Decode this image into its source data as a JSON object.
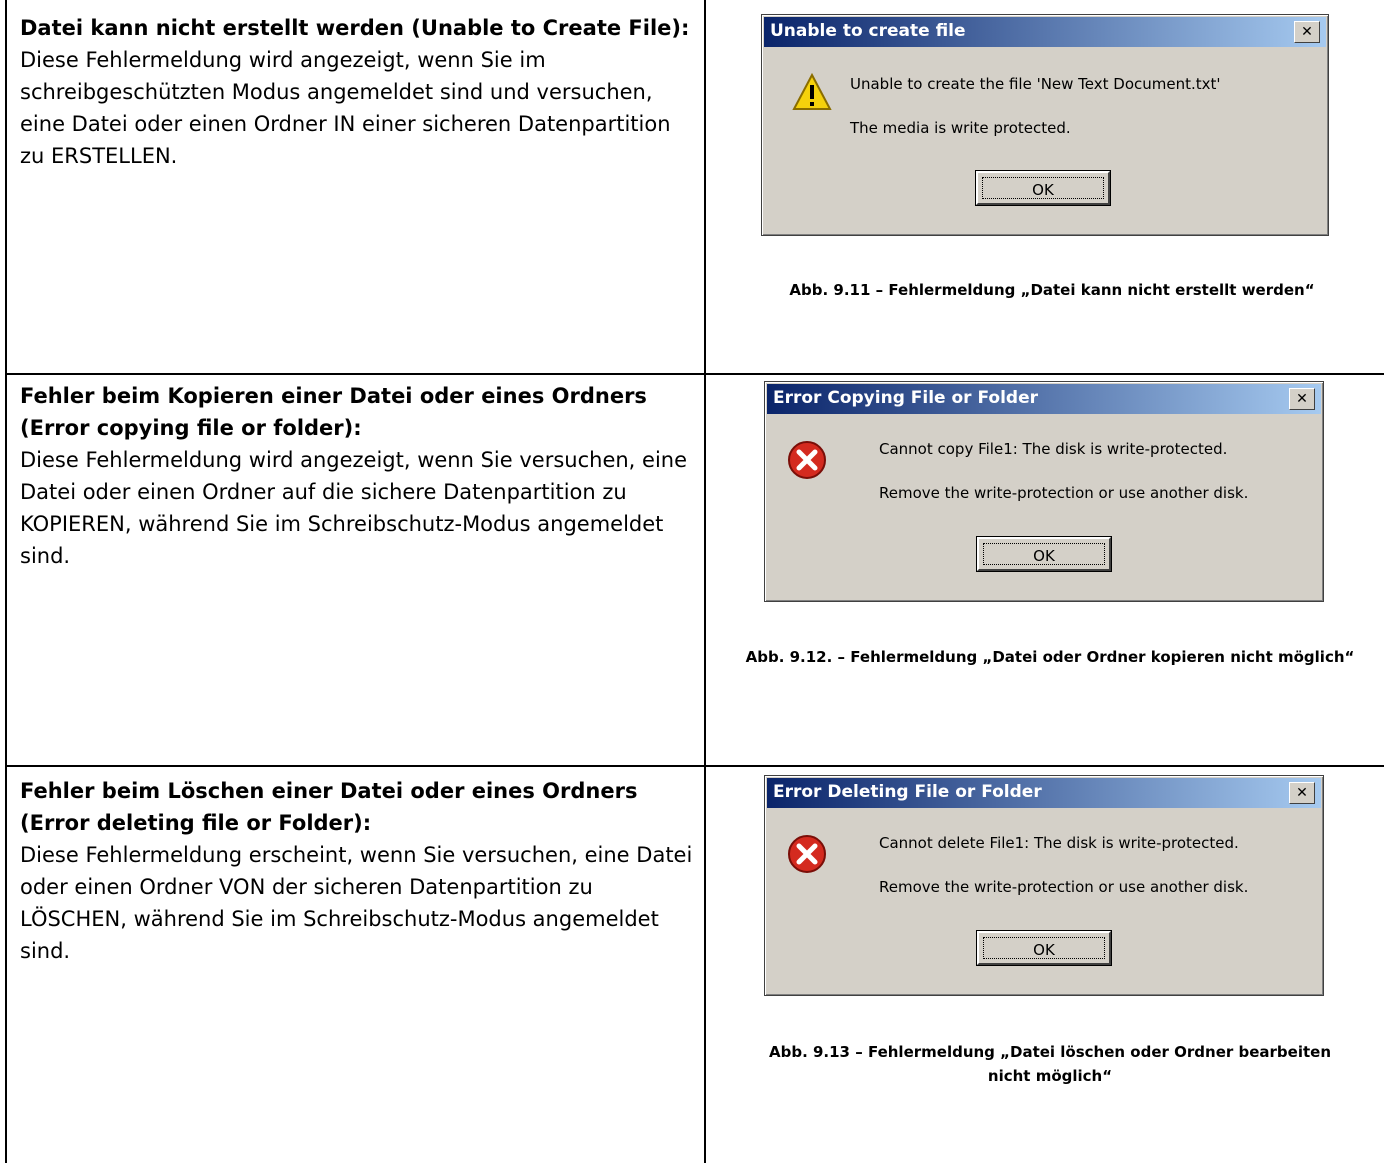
{
  "rows": [
    {
      "heading": "Datei kann nicht erstellt werden (Unable to Create File):",
      "body": "Diese Fehlermeldung wird angezeigt, wenn Sie im schreibgeschützten Modus angemeldet sind und versuchen, eine Datei oder einen Ordner IN einer sicheren Datenpartition zu ERSTELLEN.",
      "dialog": {
        "title": "Unable to create file",
        "icon": "warning-icon",
        "line1": "Unable to create the file 'New Text Document.txt'",
        "line2": "The media is write protected.",
        "ok_label": "OK",
        "close_label": "✕"
      },
      "caption": "Abb. 9.11 – Fehlermeldung „Datei kann nicht erstellt werden“"
    },
    {
      "heading": "Fehler beim Kopieren einer Datei oder eines Ordners (Error copying file or folder):",
      "body": "Diese Fehlermeldung wird angezeigt, wenn Sie versuchen, eine Datei oder einen Ordner auf die sichere Datenpartition zu KOPIEREN, während Sie im Schreibschutz-Modus angemeldet sind.",
      "dialog": {
        "title": "Error Copying File or Folder",
        "icon": "error-icon",
        "line1": "Cannot copy File1: The disk is write-protected.",
        "line2": "Remove the write-protection or use another disk.",
        "ok_label": "OK",
        "close_label": "✕"
      },
      "caption": "Abb. 9.12. – Fehlermeldung „Datei oder Ordner kopieren nicht möglich“"
    },
    {
      "heading": "Fehler beim Löschen einer Datei oder eines Ordners (Error deleting file or Folder):",
      "body": "Diese Fehlermeldung erscheint, wenn Sie versuchen, eine Datei oder einen Ordner VON der sicheren Datenpartition zu LÖSCHEN, während Sie im Schreibschutz-Modus angemeldet sind.",
      "dialog": {
        "title": "Error Deleting File or Folder",
        "icon": "error-icon",
        "line1": "Cannot delete File1: The disk is write-protected.",
        "line2": "Remove the write-protection or use another disk.",
        "ok_label": "OK",
        "close_label": "✕"
      },
      "caption": "Abb. 9.13 – Fehlermeldung „Datei löschen oder Ordner bearbeiten nicht möglich“"
    }
  ],
  "colors": {
    "title_gradient_start": "#0a246a",
    "title_gradient_end": "#a6caf0",
    "dialog_bg": "#d4d0c8",
    "error_red": "#d42a1f",
    "warning_yellow": "#f5d10c"
  }
}
